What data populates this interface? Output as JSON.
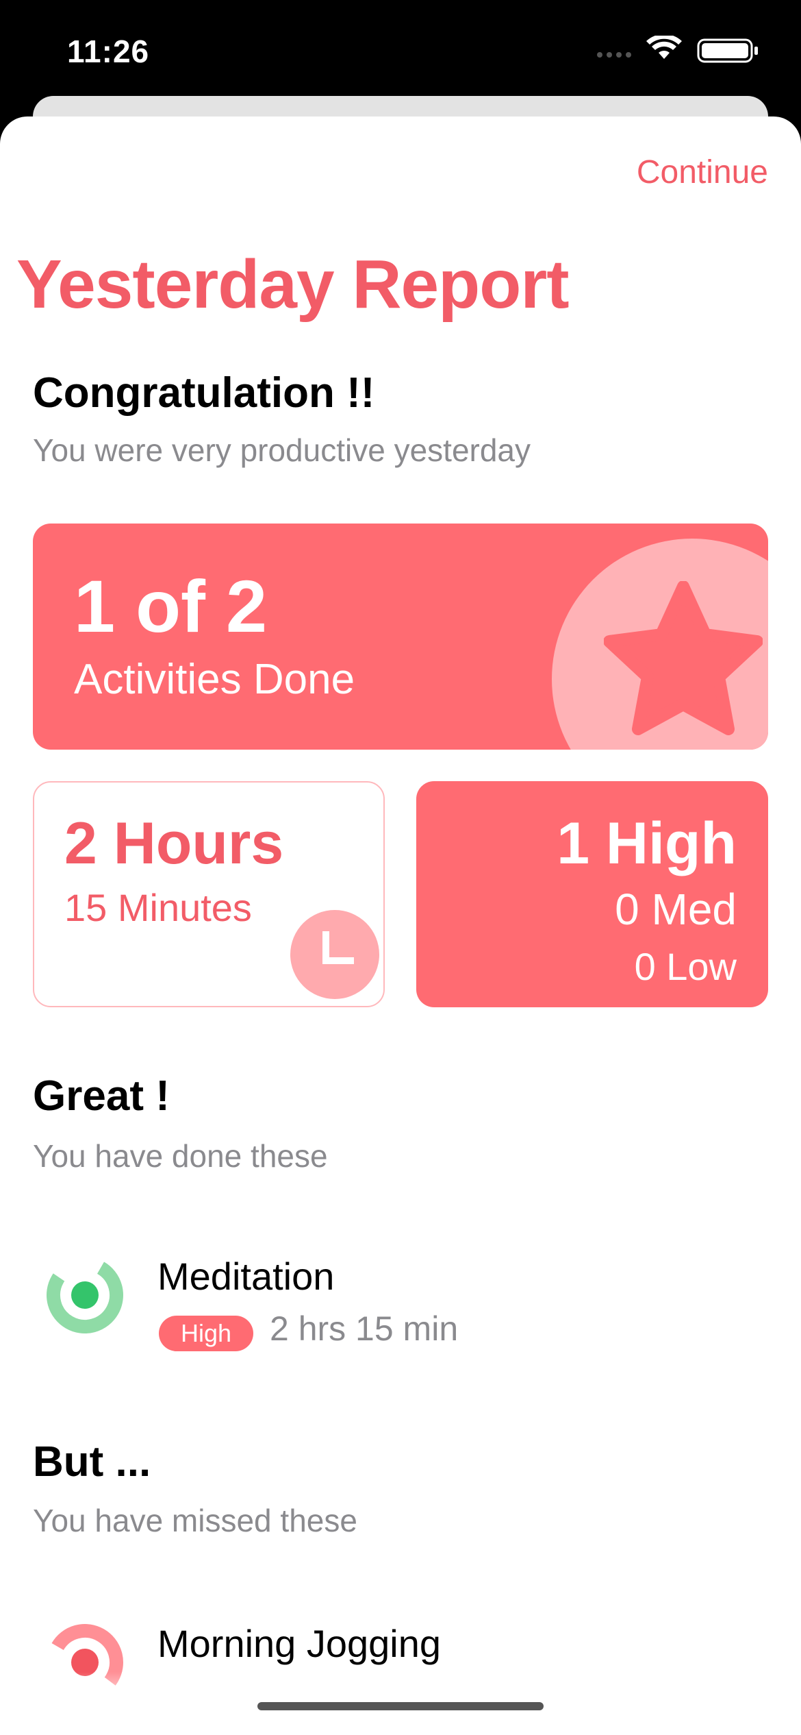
{
  "status_bar": {
    "time": "11:26"
  },
  "header": {
    "continue_label": "Continue",
    "title": "Yesterday Report"
  },
  "congrats": {
    "heading": "Congratulation !!",
    "subtitle": "You were very productive yesterday"
  },
  "activities_card": {
    "count": "1 of 2",
    "label": "Activities Done"
  },
  "time_card": {
    "hours": "2 Hours",
    "minutes": "15 Minutes"
  },
  "priority_card": {
    "high": "1 High",
    "med": "0 Med",
    "low": "0 Low"
  },
  "done_section": {
    "heading": "Great !",
    "subtitle": "You have done these",
    "items": [
      {
        "title": "Meditation",
        "priority": "High",
        "duration": "2 hrs 15 min",
        "icon": "activity-ring-green-icon"
      }
    ]
  },
  "missed_section": {
    "heading": "But ...",
    "subtitle": "You have missed these",
    "items": [
      {
        "title": "Morning Jogging",
        "icon": "activity-ring-red-icon"
      }
    ]
  },
  "colors": {
    "accent": "#f25c67",
    "card": "#ff6b72",
    "card_light": "#ffb2b6",
    "green": "#34c46b"
  }
}
